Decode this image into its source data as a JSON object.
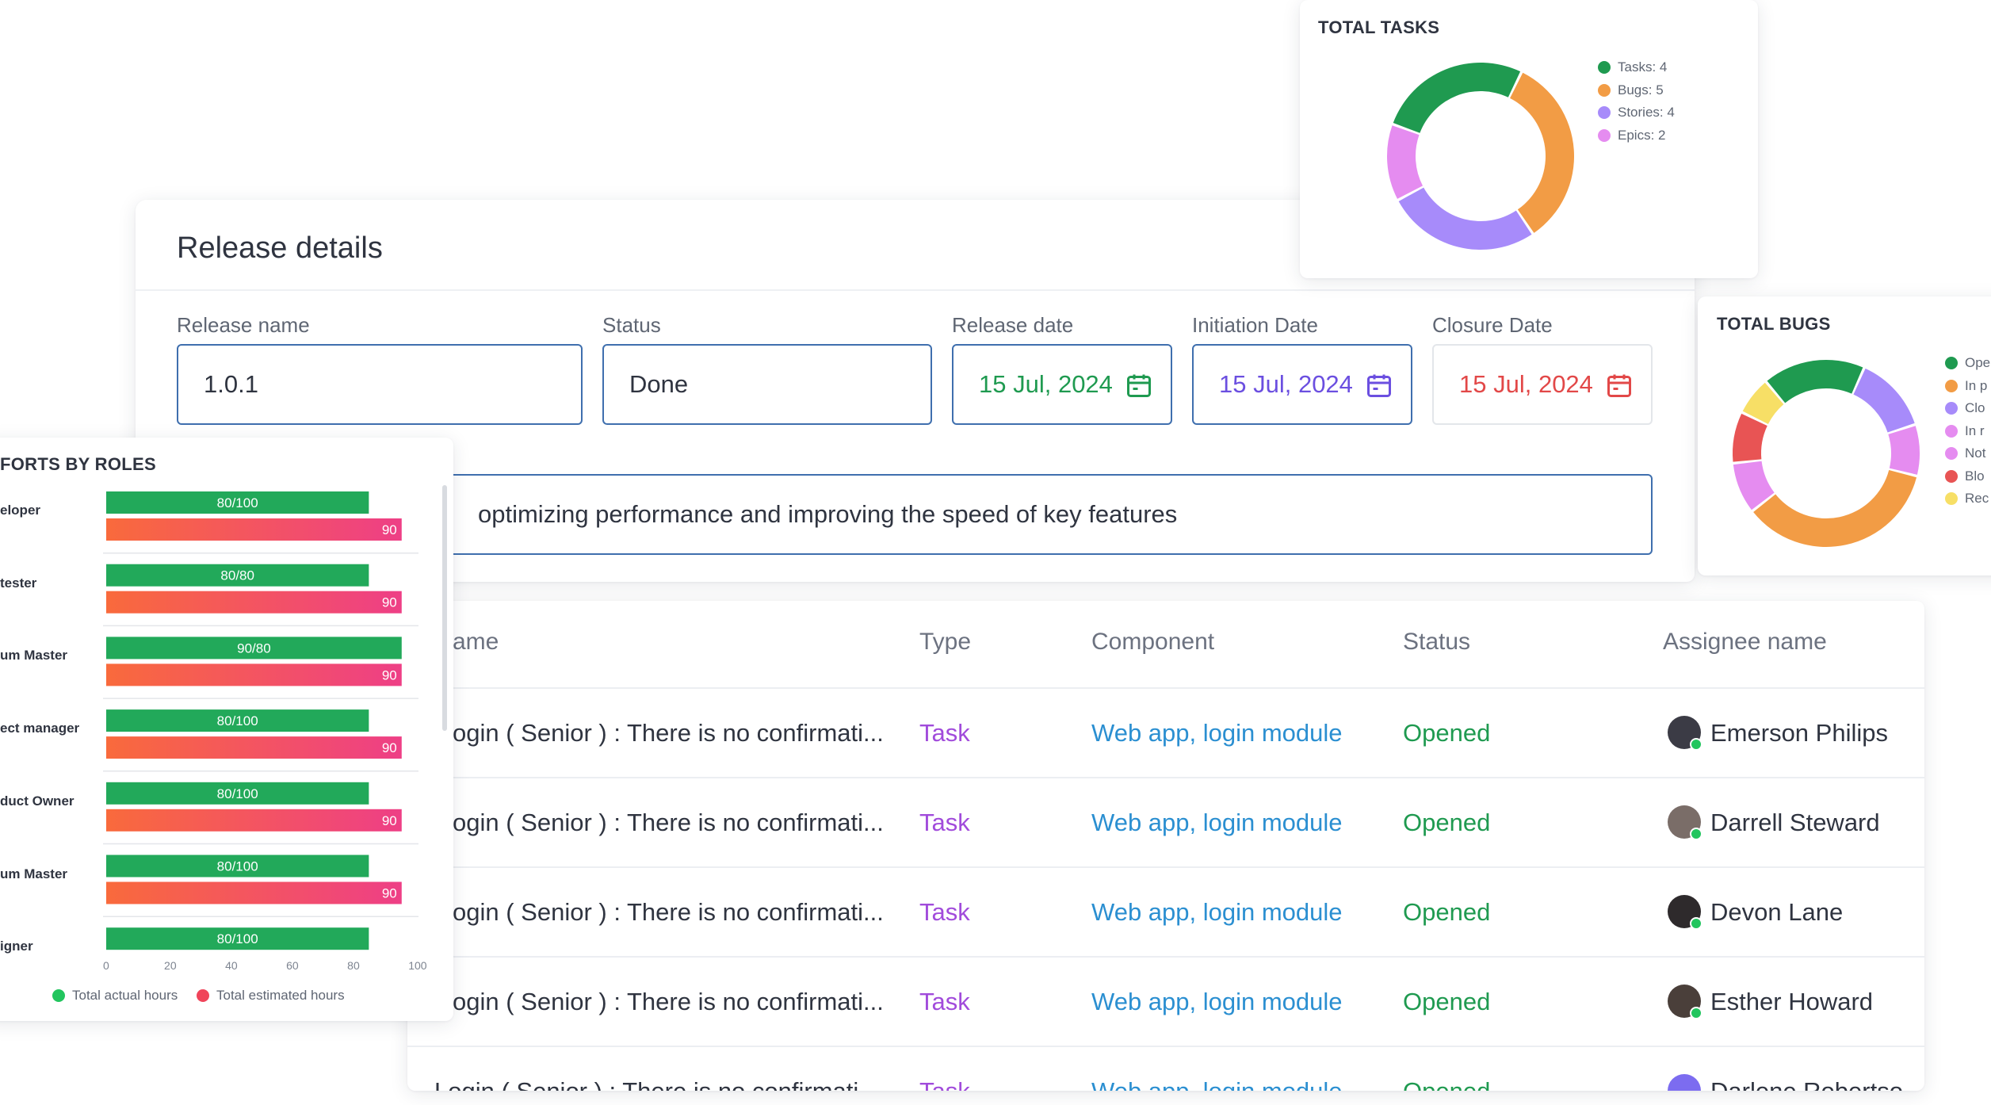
{
  "release": {
    "title": "Release details",
    "fields": {
      "name": {
        "label": "Release name",
        "value": "1.0.1"
      },
      "status": {
        "label": "Status",
        "value": "Done"
      },
      "release_date": {
        "label": "Release date",
        "value": "15 Jul, 2024"
      },
      "initiation_date": {
        "label": "Initiation Date",
        "value": "15 Jul, 2024"
      },
      "closure_date": {
        "label": "Closure Date",
        "value": "15 Jul, 2024"
      }
    },
    "description": "optimizing performance and improving the speed of key features"
  },
  "table": {
    "headers": {
      "name": "ame",
      "type": "Type",
      "component": "Component",
      "status": "Status",
      "assignee": "Assignee name"
    },
    "rows": [
      {
        "name": "ogin ( Senior ) : There is no confirmati...",
        "type": "Task",
        "component": "Web app, login module",
        "status": "Opened",
        "assignee": "Emerson Philips"
      },
      {
        "name": "ogin ( Senior ) : There is no confirmati...",
        "type": "Task",
        "component": "Web app, login module",
        "status": "Opened",
        "assignee": "Darrell Steward"
      },
      {
        "name": "ogin ( Senior ) : There is no confirmati...",
        "type": "Task",
        "component": "Web app, login module",
        "status": "Opened",
        "assignee": "Devon Lane"
      },
      {
        "name": "ogin ( Senior ) : There is no confirmati...",
        "type": "Task",
        "component": "Web app, login module",
        "status": "Opened",
        "assignee": "Esther Howard"
      },
      {
        "name": "Login ( Senior ) : There is no confirmati...",
        "type": "Task",
        "component": "Web app, login module",
        "status": "Opened",
        "assignee": "Darlene Robertso"
      }
    ]
  },
  "colors": {
    "green": "#1f9a50",
    "purple": "#6b4fe0",
    "red": "#e24848",
    "accent_border": "#3f6fae"
  },
  "chart_data": [
    {
      "type": "pie",
      "title": "TOTAL TASKS",
      "categories": [
        "Tasks",
        "Bugs",
        "Stories",
        "Epics"
      ],
      "values": [
        4,
        5,
        4,
        2
      ],
      "legend": [
        "Tasks: 4",
        "Bugs: 5",
        "Stories: 4",
        "Epics: 2"
      ],
      "colors": [
        "#1f9a50",
        "#f29c45",
        "#a78bfa",
        "#e58cf0"
      ],
      "legend_position": "right"
    },
    {
      "type": "pie",
      "title": "TOTAL BUGS",
      "categories": [
        "Ope",
        "In p",
        "Clo",
        "In r",
        "Not",
        "Blo",
        "Rec"
      ],
      "legend": [
        "Ope",
        "In p",
        "Clo",
        "In r",
        "Not",
        "Blo",
        "Rec"
      ],
      "values": [
        4,
        8,
        3,
        2,
        2,
        2,
        1.5
      ],
      "colors": [
        "#1f9a50",
        "#f29c45",
        "#a78bfa",
        "#e58cf0",
        "#e58cf0",
        "#e85454",
        "#f7df66"
      ],
      "slice_order": [
        0,
        2,
        3,
        1,
        4,
        5,
        6
      ],
      "legend_position": "right"
    },
    {
      "type": "bar",
      "title": "FORTS BY ROLES",
      "orientation": "horizontal",
      "categories": [
        "eloper",
        "tester",
        "um Master",
        "ect manager",
        "duct Owner",
        "um Master",
        "igner"
      ],
      "series": [
        {
          "name": "Total actual hours",
          "values": [
            80,
            80,
            90,
            80,
            80,
            80,
            80
          ],
          "labels": [
            "80/100",
            "80/80",
            "90/80",
            "80/100",
            "80/100",
            "80/100",
            "80/100"
          ],
          "color": "#22a95a"
        },
        {
          "name": "Total estimated hours",
          "values": [
            90,
            90,
            90,
            90,
            90,
            90,
            null
          ],
          "labels": [
            "90",
            "90",
            "90",
            "90",
            "90",
            "90",
            ""
          ],
          "color": "#f4504f"
        }
      ],
      "xticks": [
        "0",
        "20",
        "40",
        "60",
        "80",
        "100"
      ],
      "xlim": [
        0,
        100
      ],
      "legend_position": "bottom"
    }
  ]
}
